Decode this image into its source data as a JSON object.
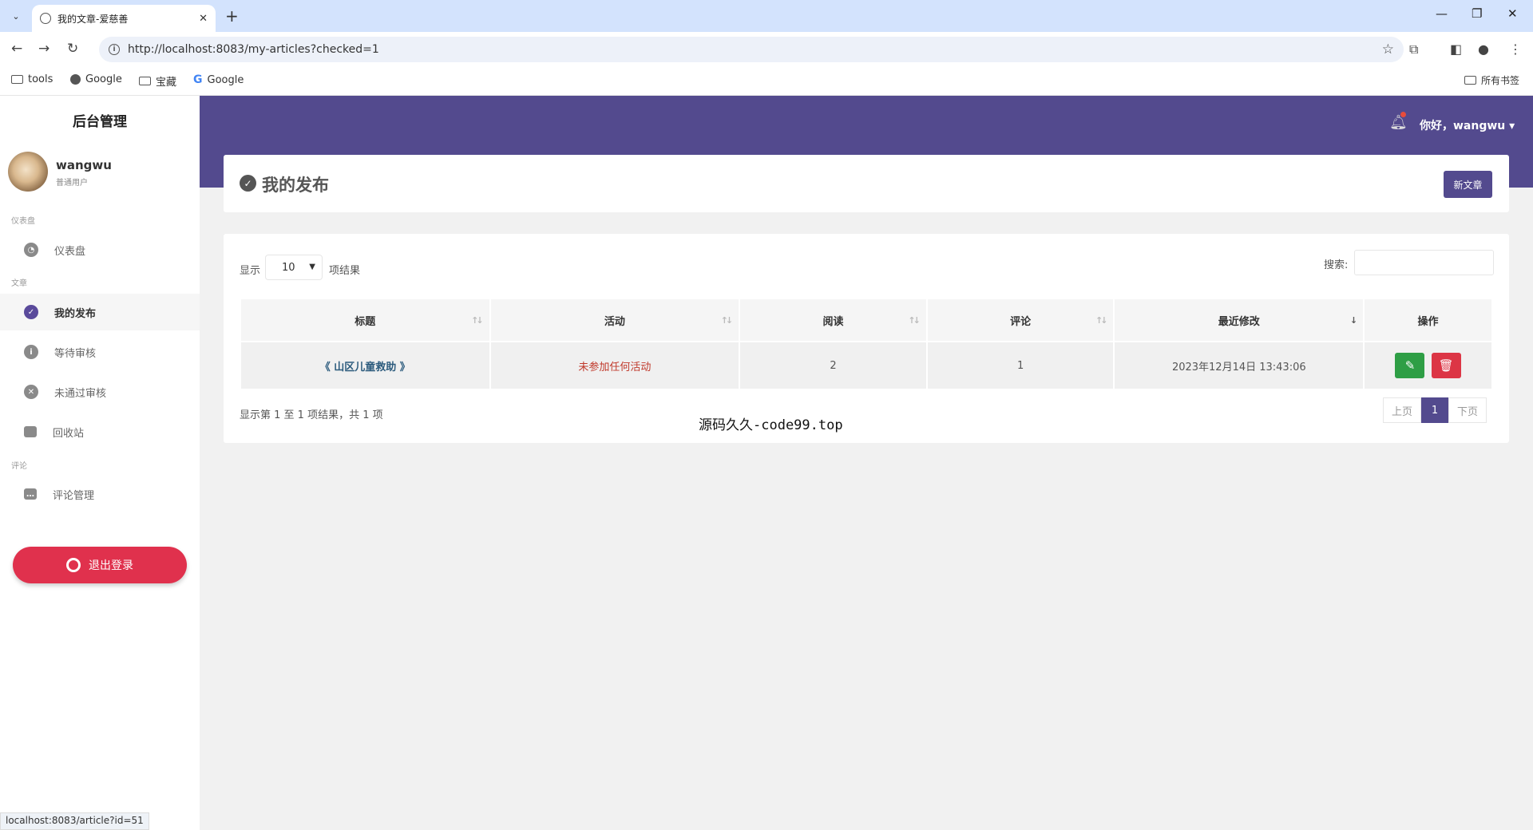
{
  "browser": {
    "tab_title": "我的文章-爱慈善",
    "url": "http://localhost:8083/my-articles?checked=1",
    "bookmarks": [
      "tools",
      "Google",
      "宝藏",
      "Google"
    ],
    "all_bookmarks": "所有书签",
    "status_url": "localhost:8083/article?id=51"
  },
  "sidebar": {
    "brand": "后台管理",
    "user": {
      "name": "wangwu",
      "role": "普通用户"
    },
    "sections": {
      "dashboard": "仪表盘",
      "articles": "文章",
      "comments": "评论"
    },
    "items": [
      {
        "label": "仪表盘",
        "icon": "dashboard-icon"
      },
      {
        "label": "我的发布",
        "icon": "check-circle-icon",
        "active": true
      },
      {
        "label": "等待审核",
        "icon": "info-icon"
      },
      {
        "label": "未通过审核",
        "icon": "x-circle-icon"
      },
      {
        "label": "回收站",
        "icon": "trash-icon"
      },
      {
        "label": "评论管理",
        "icon": "comment-icon"
      }
    ],
    "logout": "退出登录"
  },
  "header": {
    "greeting": "你好，wangwu",
    "page_title": "我的发布",
    "new_button": "新文章"
  },
  "table": {
    "length_label": "显示",
    "length_value": "10",
    "length_suffix": "项结果",
    "search_label": "搜索:",
    "columns": [
      "标题",
      "活动",
      "阅读",
      "评论",
      "最近修改",
      "操作"
    ],
    "rows": [
      {
        "title": "《 山区儿童救助 》",
        "activity": "未参加任何活动",
        "reads": "2",
        "comments": "1",
        "modified": "2023年12月14日 13:43:06"
      }
    ],
    "info": "显示第 1 至 1 项结果，共 1 项",
    "pager": {
      "prev": "上页",
      "current": "1",
      "next": "下页"
    }
  },
  "overlay_text": "源码久久-code99.top",
  "colors": {
    "primary": "#534a8e",
    "danger": "#e0314d",
    "success": "#2e9e45"
  }
}
